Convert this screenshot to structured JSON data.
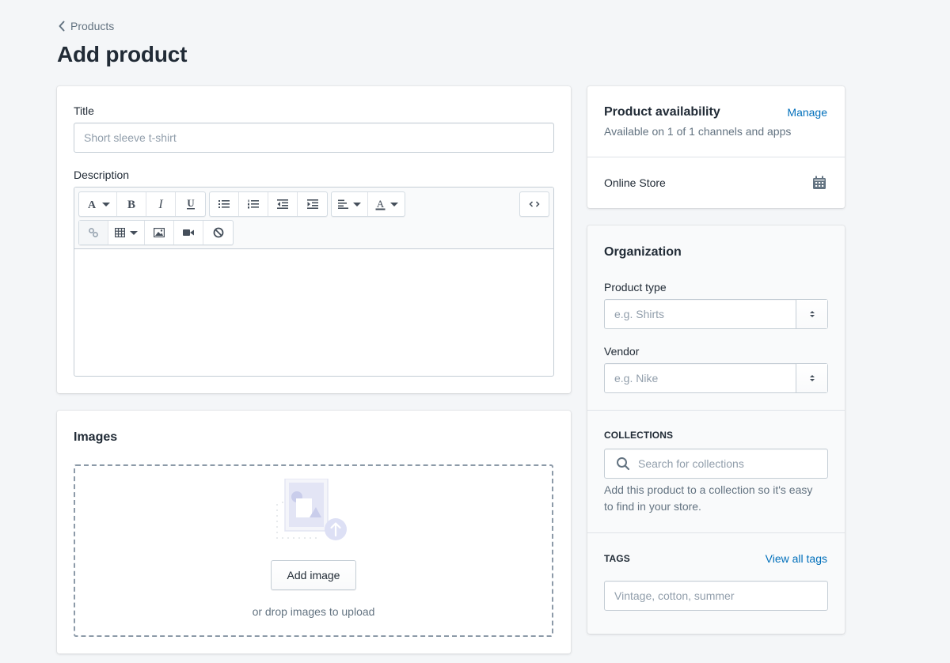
{
  "breadcrumb": {
    "label": "Products",
    "icon": "chevron-left-icon"
  },
  "page": {
    "title": "Add product"
  },
  "main_card": {
    "title_label": "Title",
    "title_value": "",
    "title_placeholder": "Short sleeve t-shirt",
    "description_label": "Description",
    "toolbar": {
      "row1": [
        {
          "icon": "text-style-icon",
          "glyph": "A",
          "dropdown": true
        },
        {
          "icon": "bold-icon",
          "glyph": "B"
        },
        {
          "icon": "italic-icon",
          "glyph": "I"
        },
        {
          "icon": "underline-icon",
          "glyph": "U"
        },
        {
          "icon": "bulleted-list-icon"
        },
        {
          "icon": "numbered-list-icon"
        },
        {
          "icon": "outdent-icon"
        },
        {
          "icon": "indent-icon"
        },
        {
          "icon": "align-left-icon",
          "dropdown": true
        },
        {
          "icon": "text-color-icon",
          "glyph": "A",
          "dropdown": true
        },
        {
          "icon": "code-view-icon",
          "glyph": "<>"
        }
      ],
      "row2": [
        {
          "icon": "link-icon",
          "disabled": true
        },
        {
          "icon": "table-icon",
          "dropdown": true
        },
        {
          "icon": "insert-image-icon"
        },
        {
          "icon": "insert-video-icon"
        },
        {
          "icon": "clear-formatting-icon"
        }
      ]
    },
    "description_value": ""
  },
  "images_card": {
    "heading": "Images",
    "add_button": "Add image",
    "hint": "or drop images to upload"
  },
  "availability_card": {
    "heading": "Product availability",
    "manage_link": "Manage",
    "summary": "Available on 1 of 1 channels and apps",
    "channels": [
      {
        "name": "Online Store",
        "icon": "calendar-icon"
      }
    ]
  },
  "organization_card": {
    "heading": "Organization",
    "product_type_label": "Product type",
    "product_type_placeholder": "e.g. Shirts",
    "vendor_label": "Vendor",
    "vendor_placeholder": "e.g. Nike",
    "collections_heading": "COLLECTIONS",
    "collections_placeholder": "Search for collections",
    "collections_help": "Add this product to a collection so it's easy to find in your store.",
    "tags_heading": "TAGS",
    "tags_link": "View all tags",
    "tags_placeholder": "Vintage, cotton, summer"
  },
  "colors": {
    "background": "#f4f6f8",
    "link": "#006fbb",
    "text": "#212b36",
    "subdued": "#637381",
    "border": "#c4cdd5"
  }
}
